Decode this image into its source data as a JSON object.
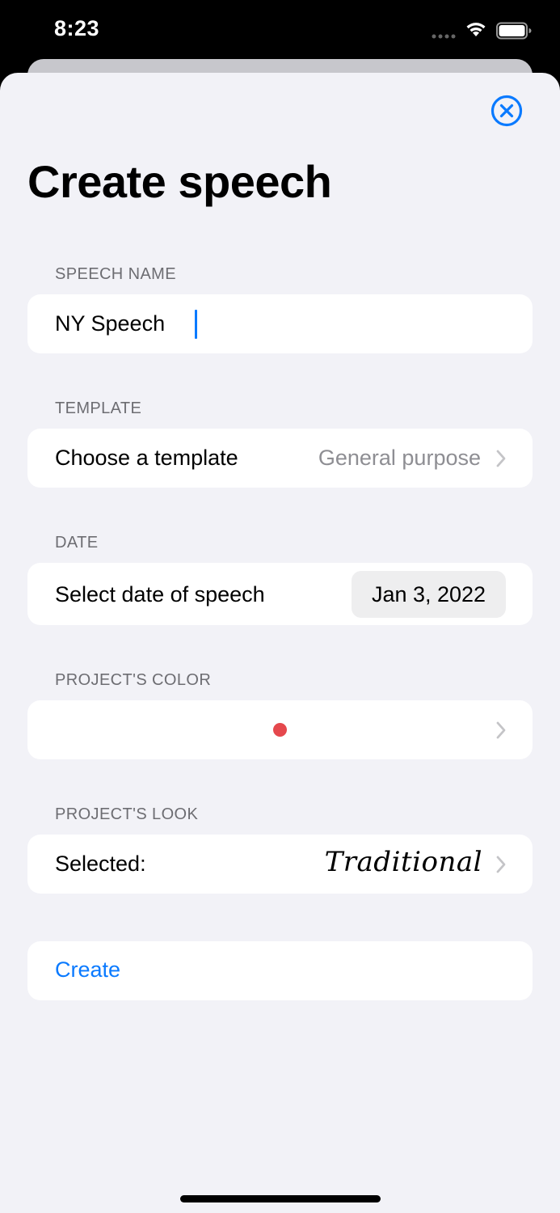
{
  "status_bar": {
    "time": "8:23",
    "signal_icon": "cellular-dots-icon",
    "wifi_icon": "wifi-icon",
    "battery_icon": "battery-icon"
  },
  "sheet": {
    "close_icon": "xmark-circle-icon",
    "title": "Create speech"
  },
  "speech_name": {
    "header": "SPEECH NAME",
    "value": "NY Speech"
  },
  "template": {
    "header": "TEMPLATE",
    "label": "Choose a template",
    "value": "General purpose"
  },
  "date": {
    "header": "DATE",
    "label": "Select date of speech",
    "value": "Jan 3, 2022"
  },
  "project_color": {
    "header": "PROJECT'S COLOR",
    "color": "#e5484d"
  },
  "project_look": {
    "header": "PROJECT'S LOOK",
    "label": "Selected:",
    "value": "Traditional"
  },
  "actions": {
    "create_label": "Create"
  },
  "colors": {
    "accent": "#0a7aff",
    "background": "#f2f2f7",
    "secondary_text": "#8e8e93"
  }
}
